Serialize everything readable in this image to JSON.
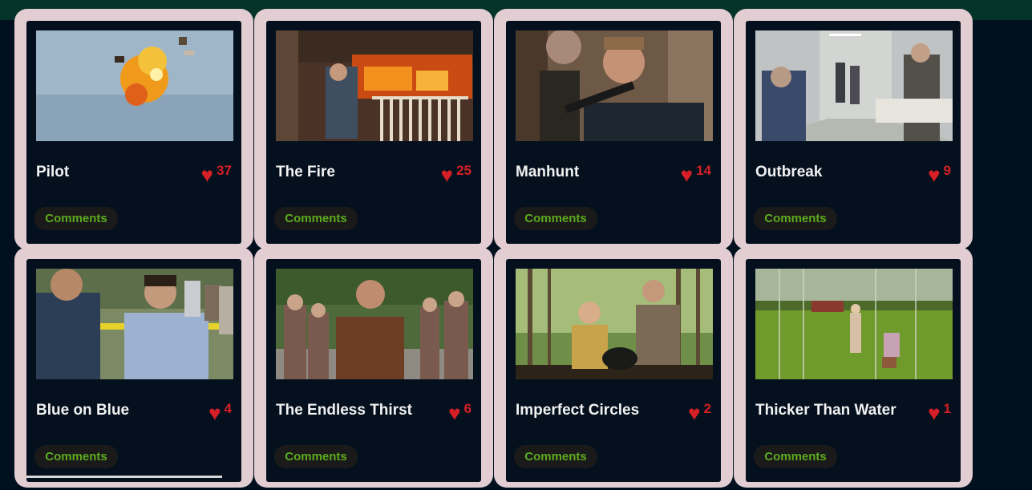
{
  "colors": {
    "page_background": "#01101f",
    "top_bar": "#043329",
    "card_frame": "#e2cdd2",
    "card_background": "#04101e",
    "heart": "#d61f26",
    "comments_text": "#5cab1e",
    "comments_background": "#1b1a1a"
  },
  "icons": {
    "like": "heart-icon"
  },
  "episodes": [
    {
      "title": "Pilot",
      "likes": "37",
      "comments_label": "Comments"
    },
    {
      "title": "The Fire",
      "likes": "25",
      "comments_label": "Comments"
    },
    {
      "title": "Manhunt",
      "likes": "14",
      "comments_label": "Comments"
    },
    {
      "title": "Outbreak",
      "likes": "9",
      "comments_label": "Comments"
    },
    {
      "title": "Blue on Blue",
      "likes": "4",
      "comments_label": "Comments"
    },
    {
      "title": "The Endless Thirst",
      "likes": "6",
      "comments_label": "Comments"
    },
    {
      "title": "Imperfect Circles",
      "likes": "2",
      "comments_label": "Comments"
    },
    {
      "title": "Thicker Than Water",
      "likes": "1",
      "comments_label": "Comments"
    }
  ]
}
